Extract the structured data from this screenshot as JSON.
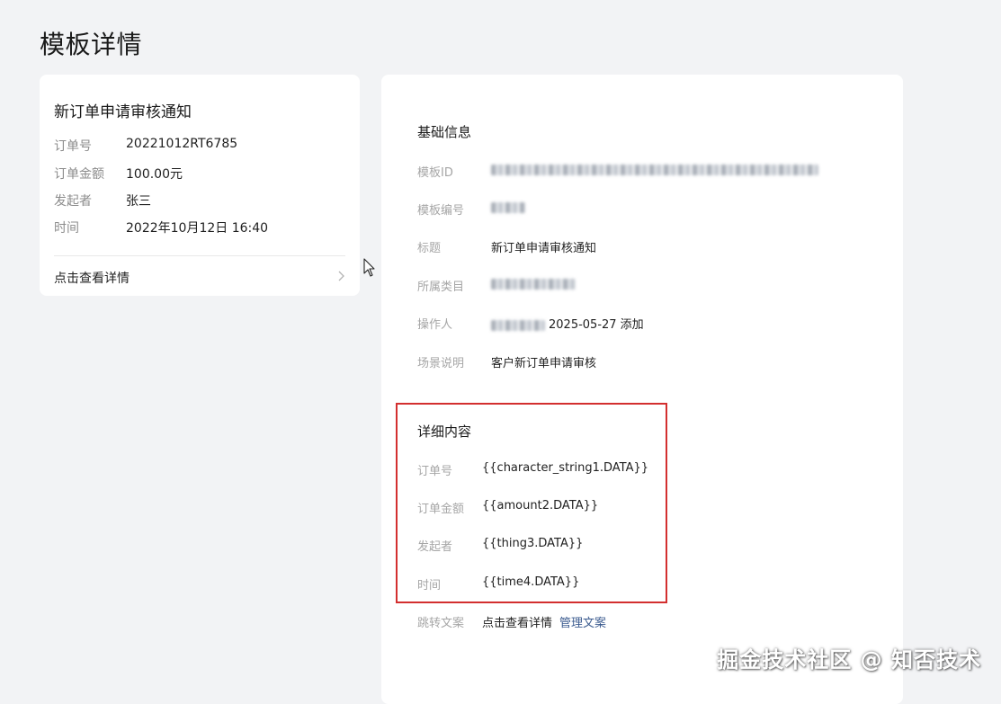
{
  "page": {
    "title": "模板详情"
  },
  "preview": {
    "title": "新订单申请审核通知",
    "fields": [
      {
        "label": "订单号",
        "value": "20221012RT6785"
      },
      {
        "label": "订单金额",
        "value": "100.00元"
      },
      {
        "label": "发起者",
        "value": "张三"
      },
      {
        "label": "时间",
        "value": "2022年10月12日 16:40"
      }
    ],
    "link_label": "点击查看详情",
    "chevron_icon": "chevron-right-icon"
  },
  "basic_info": {
    "title": "基础信息",
    "template_id": {
      "label": "模板ID"
    },
    "template_no": {
      "label": "模板编号"
    },
    "subject": {
      "label": "标题",
      "value": "新订单申请审核通知"
    },
    "category": {
      "label": "所属类目"
    },
    "operator": {
      "label": "操作人",
      "date_action": "2025-05-27 添加"
    },
    "scene": {
      "label": "场景说明",
      "value": "客户新订单申请审核"
    }
  },
  "detail": {
    "title": "详细内容",
    "fields": [
      {
        "label": "订单号",
        "value": "{{character_string1.DATA}}"
      },
      {
        "label": "订单金额",
        "value": "{{amount2.DATA}}"
      },
      {
        "label": "发起者",
        "value": "{{thing3.DATA}}"
      },
      {
        "label": "时间",
        "value": "{{time4.DATA}}"
      }
    ],
    "highlight_color": "#d32f2f"
  },
  "jump": {
    "label": "跳转文案",
    "value": "点击查看详情",
    "manage_link": "管理文案",
    "link_color": "#3b5b8f"
  },
  "watermark": "掘金技术社区 @ 知否技术"
}
